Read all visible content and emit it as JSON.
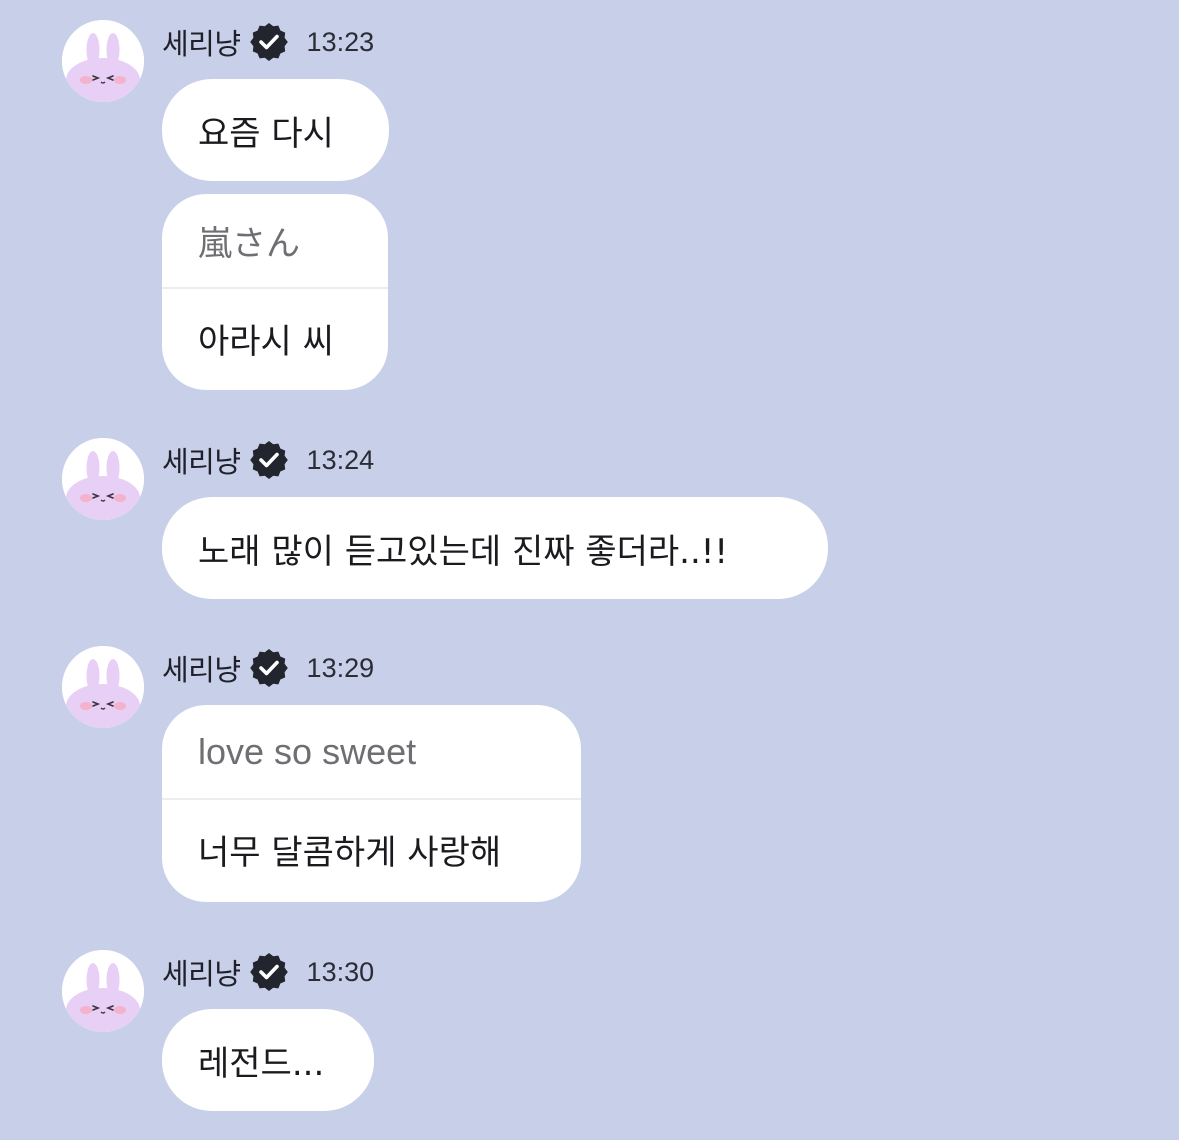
{
  "sender": {
    "name": "세리냥",
    "avatar_icon": "bunny-avatar-icon",
    "badge_icon": "verified-badge-icon"
  },
  "messages": [
    {
      "time": "13:23",
      "bubbles": [
        {
          "text": "요즘 다시"
        },
        {
          "quote": "嵐さん",
          "text": "아라시 씨"
        }
      ]
    },
    {
      "time": "13:24",
      "bubbles": [
        {
          "text": "노래 많이 듣고있는데 진짜 좋더라..!!"
        }
      ]
    },
    {
      "time": "13:29",
      "bubbles": [
        {
          "quote": "love so sweet",
          "text": "너무 달콤하게 사랑해"
        }
      ]
    },
    {
      "time": "13:30",
      "bubbles": [
        {
          "text": "레전드..."
        }
      ]
    }
  ],
  "colors": {
    "background": "#c8cfe8",
    "bubble": "#ffffff",
    "text": "#1b1b1f",
    "quote_text": "#6e6e73",
    "avatar_bunny": "#e7cff5",
    "blush": "#f4b3cc",
    "badge": "#23252e"
  }
}
